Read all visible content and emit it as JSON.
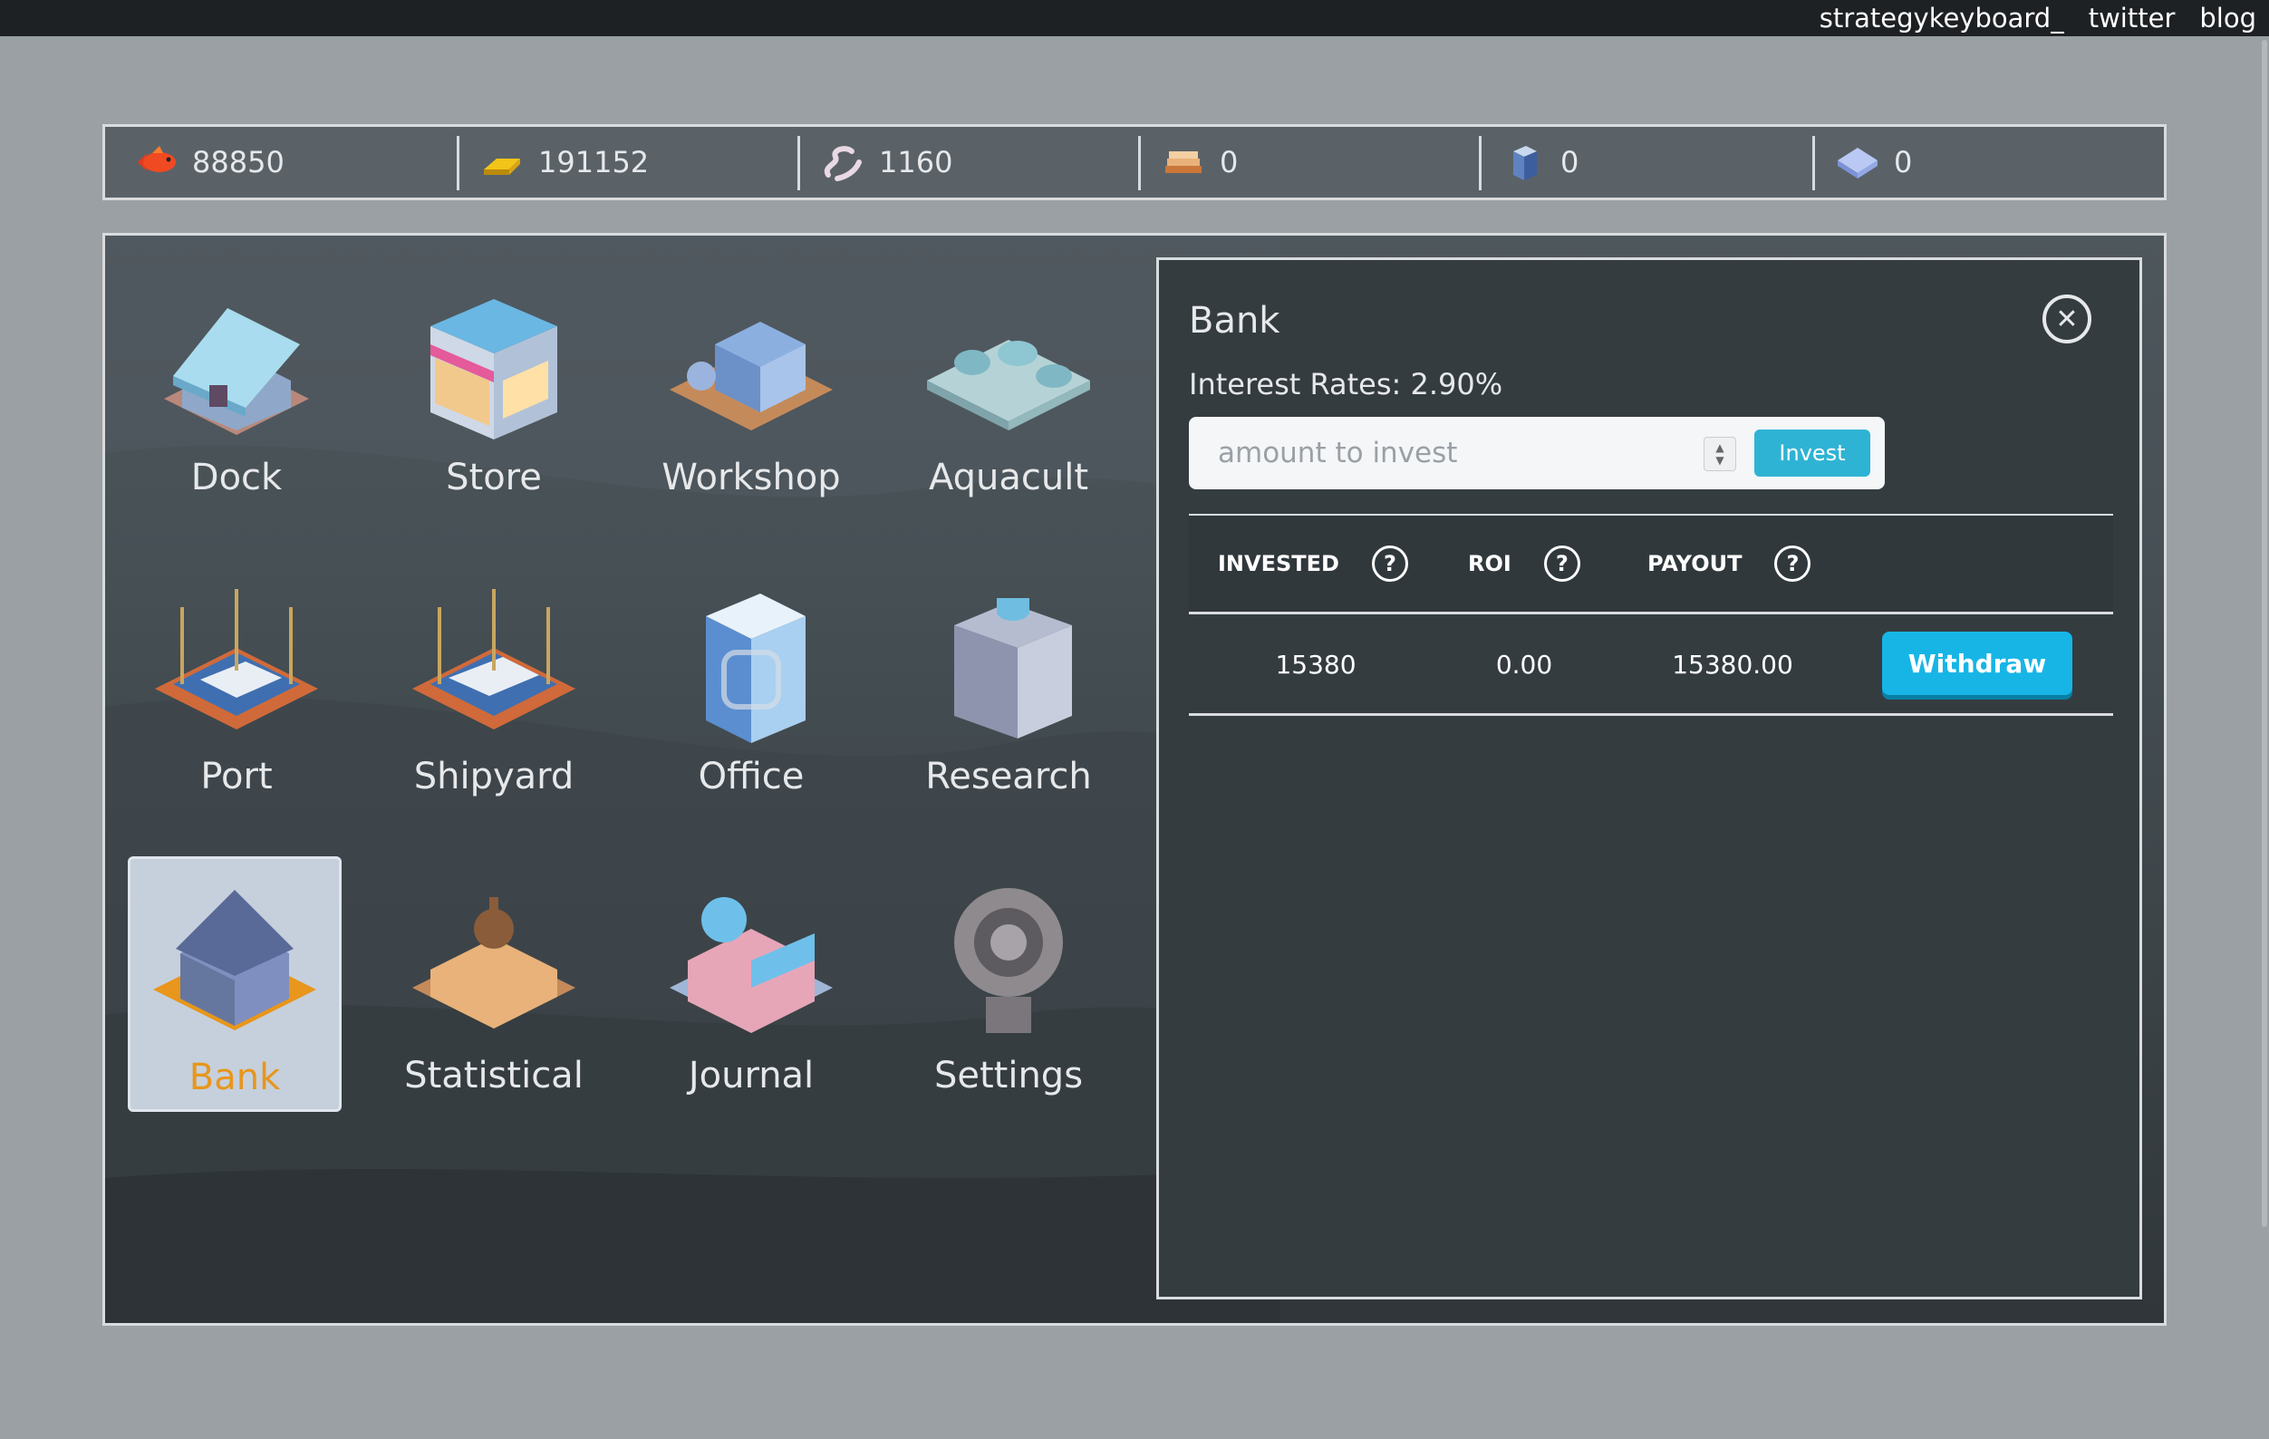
{
  "nav": {
    "links": [
      "strategykeyboard_",
      "twitter",
      "blog"
    ]
  },
  "resources": [
    {
      "icon": "fish-icon",
      "value": "88850"
    },
    {
      "icon": "gold-bar-icon",
      "value": "191152"
    },
    {
      "icon": "worm-icon",
      "value": "1160"
    },
    {
      "icon": "wood-planks-icon",
      "value": "0"
    },
    {
      "icon": "steel-block-icon",
      "value": "0"
    },
    {
      "icon": "crystal-icon",
      "value": "0"
    }
  ],
  "buildings": [
    {
      "id": "dock",
      "label": "Dock",
      "selected": false
    },
    {
      "id": "store",
      "label": "Store",
      "selected": false
    },
    {
      "id": "workshop",
      "label": "Workshop",
      "selected": false
    },
    {
      "id": "aquacult",
      "label": "Aquacult",
      "selected": false
    },
    {
      "id": "port",
      "label": "Port",
      "selected": false
    },
    {
      "id": "shipyard",
      "label": "Shipyard",
      "selected": false
    },
    {
      "id": "office",
      "label": "Office",
      "selected": false
    },
    {
      "id": "research",
      "label": "Research",
      "selected": false
    },
    {
      "id": "bank",
      "label": "Bank",
      "selected": true
    },
    {
      "id": "statistical",
      "label": "Statistical",
      "selected": false
    },
    {
      "id": "journal",
      "label": "Journal",
      "selected": false
    },
    {
      "id": "settings",
      "label": "Settings",
      "selected": false
    }
  ],
  "bank": {
    "title": "Bank",
    "interest_rate": "Interest Rates: 2.90%",
    "input_placeholder": "amount to invest",
    "input_value": "",
    "invest_label": "Invest",
    "columns": [
      "INVESTED",
      "ROI",
      "PAYOUT"
    ],
    "rows": [
      {
        "invested": "15380",
        "roi": "0.00",
        "payout": "15380.00",
        "action": "Withdraw"
      }
    ]
  },
  "colors": {
    "accent": "#17b5e6",
    "selected_label": "#e8961c",
    "panel": "#343c40"
  }
}
